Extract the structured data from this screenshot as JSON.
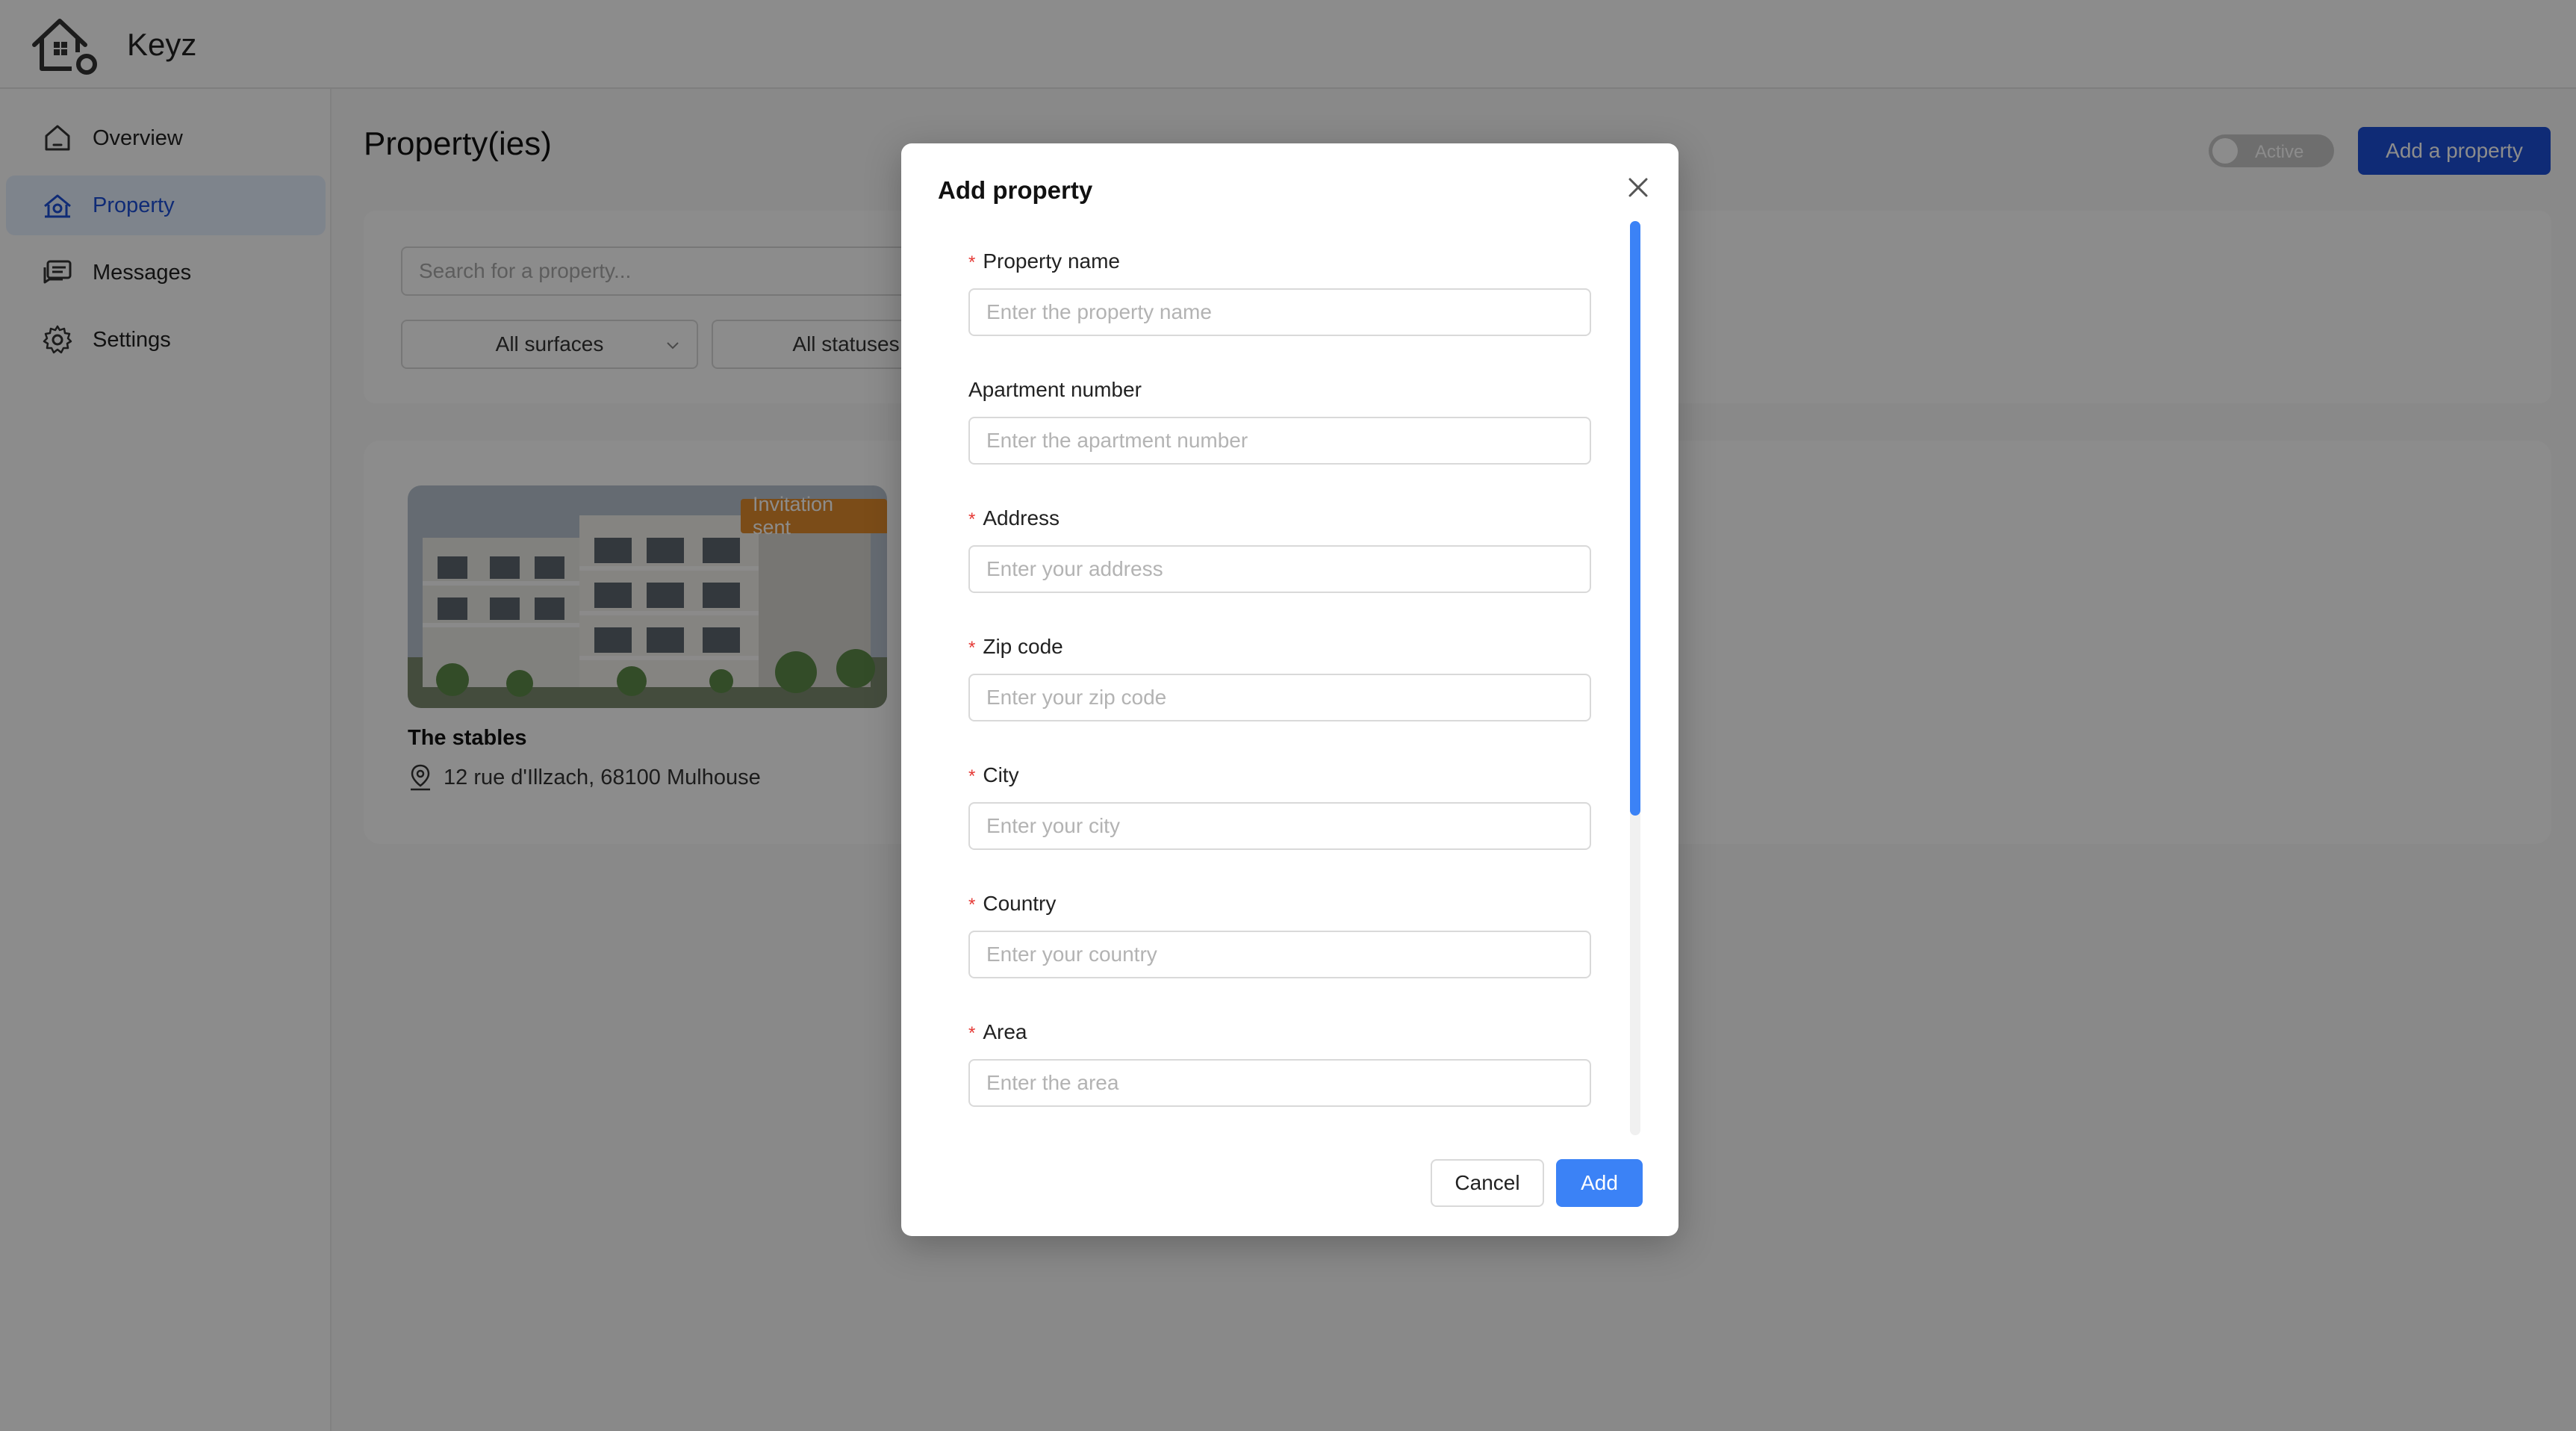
{
  "app": {
    "name": "Keyz"
  },
  "sidebar": {
    "items": [
      {
        "label": "Overview",
        "icon": "home-icon",
        "active": false
      },
      {
        "label": "Property",
        "icon": "property-icon",
        "active": true
      },
      {
        "label": "Messages",
        "icon": "messages-icon",
        "active": false
      },
      {
        "label": "Settings",
        "icon": "gear-icon",
        "active": false
      }
    ]
  },
  "page": {
    "title": "Property(ies)",
    "toggle_label": "Active",
    "add_button": "Add a property",
    "search_placeholder": "Search for a property...",
    "filters": [
      "All surfaces",
      "All statuses"
    ]
  },
  "properties": [
    {
      "name": "The stables",
      "address": "12 rue d'Illzach, 68100 Mulhouse",
      "badge": "Invitation sent"
    }
  ],
  "modal": {
    "title": "Add property",
    "fields": [
      {
        "label": "Property name",
        "placeholder": "Enter the property name",
        "required": true
      },
      {
        "label": "Apartment number",
        "placeholder": "Enter the apartment number",
        "required": false
      },
      {
        "label": "Address",
        "placeholder": "Enter your address",
        "required": true
      },
      {
        "label": "Zip code",
        "placeholder": "Enter your zip code",
        "required": true
      },
      {
        "label": "City",
        "placeholder": "Enter your city",
        "required": true
      },
      {
        "label": "Country",
        "placeholder": "Enter your country",
        "required": true
      },
      {
        "label": "Area",
        "placeholder": "Enter the area",
        "required": true
      }
    ],
    "cancel": "Cancel",
    "submit": "Add"
  },
  "colors": {
    "primary": "#1d4fd8",
    "accent": "#3b82f6",
    "badge": "#e08a2c",
    "required": "#e53935"
  }
}
